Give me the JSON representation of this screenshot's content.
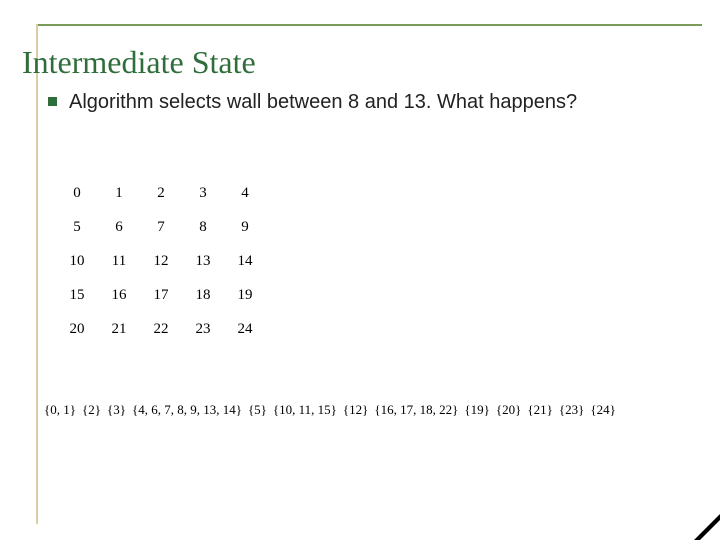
{
  "title": "Intermediate State",
  "bullet": "Algorithm selects wall between 8 and 13.  What happens?",
  "maze": {
    "rows": [
      [
        "0",
        "1",
        "2",
        "3",
        "4"
      ],
      [
        "5",
        "6",
        "7",
        "8",
        "9"
      ],
      [
        "10",
        "11",
        "12",
        "13",
        "14"
      ],
      [
        "15",
        "16",
        "17",
        "18",
        "19"
      ],
      [
        "20",
        "21",
        "22",
        "23",
        "24"
      ]
    ],
    "right_walls": [
      [
        false,
        false,
        false,
        true,
        false
      ],
      [
        true,
        false,
        false,
        false,
        false
      ],
      [
        false,
        false,
        false,
        false,
        false
      ],
      [
        true,
        false,
        false,
        true,
        false
      ],
      [
        false,
        false,
        false,
        true,
        false
      ]
    ],
    "bottom_walls": [
      [
        false,
        true,
        true,
        false,
        true
      ],
      [
        true,
        false,
        false,
        false,
        false
      ],
      [
        false,
        true,
        true,
        true,
        true
      ],
      [
        false,
        false,
        false,
        false,
        true
      ],
      [
        false,
        false,
        false,
        false,
        false
      ]
    ]
  },
  "sets": [
    "{0, 1}",
    "{2}",
    "{3}",
    "{4, 6, 7, 8, 9, 13, 14}",
    "{5}",
    "{10, 11, 15}",
    "{12}",
    "{16, 17, 18, 22}",
    "{19}",
    "{20}",
    "{21}",
    "{23}",
    "{24}"
  ]
}
